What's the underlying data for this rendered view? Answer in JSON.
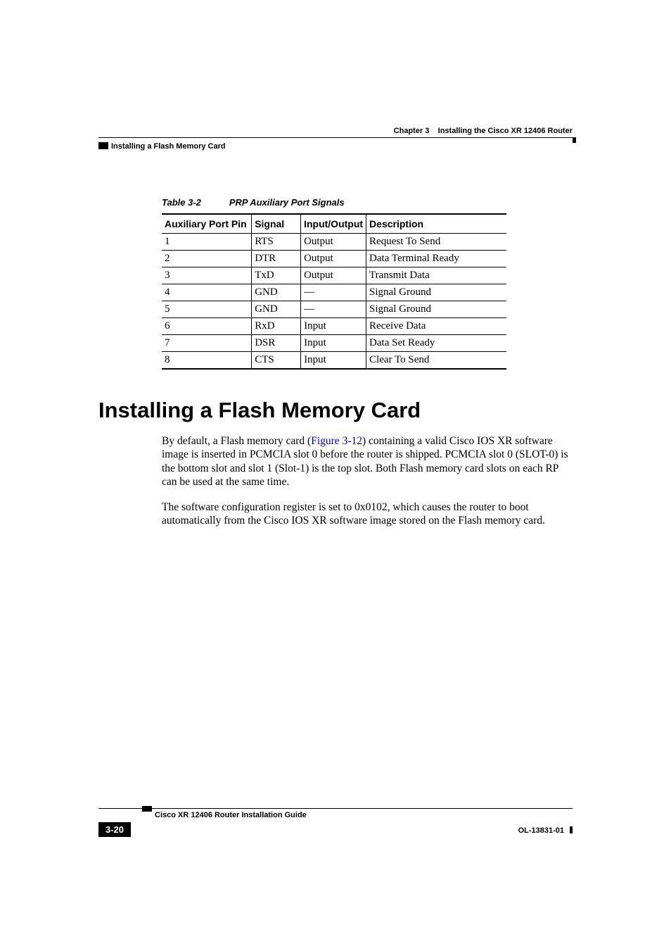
{
  "header": {
    "chapter_label": "Chapter 3",
    "chapter_title": "Installing the Cisco XR 12406 Router",
    "section_name": "Installing a Flash Memory Card"
  },
  "table": {
    "number": "Table 3-2",
    "title": "PRP Auxiliary Port Signals",
    "headers": [
      "Auxiliary Port Pin",
      "Signal",
      "Input/Output",
      "Description"
    ],
    "rows": [
      {
        "pin": "1",
        "signal": "RTS",
        "io": "Output",
        "desc": "Request To Send"
      },
      {
        "pin": "2",
        "signal": "DTR",
        "io": "Output",
        "desc": "Data Terminal Ready"
      },
      {
        "pin": "3",
        "signal": "TxD",
        "io": "Output",
        "desc": "Transmit Data"
      },
      {
        "pin": "4",
        "signal": "GND",
        "io": "—",
        "desc": "Signal Ground"
      },
      {
        "pin": "5",
        "signal": "GND",
        "io": "—",
        "desc": "Signal Ground"
      },
      {
        "pin": "6",
        "signal": "RxD",
        "io": "Input",
        "desc": "Receive Data"
      },
      {
        "pin": "7",
        "signal": "DSR",
        "io": "Input",
        "desc": "Data Set Ready"
      },
      {
        "pin": "8",
        "signal": "CTS",
        "io": "Input",
        "desc": "Clear To Send"
      }
    ]
  },
  "heading": "Installing a Flash Memory Card",
  "paragraphs": {
    "p1_part1": "By default, a Flash memory card (",
    "p1_link": "Figure 3-12",
    "p1_part2": ") containing a valid Cisco IOS XR software image is inserted in PCMCIA slot 0 before the router is shipped. PCMCIA slot 0 (SLOT-0) is the bottom slot and slot 1 (Slot-1) is the top slot. Both Flash memory card slots on each RP can be used at the same time.",
    "p2": "The software configuration register is set to 0x0102, which causes the router to boot automatically from the Cisco IOS XR software image stored on the Flash memory card."
  },
  "footer": {
    "guide_title": "Cisco XR 12406 Router Installation Guide",
    "page_number": "3-20",
    "doc_id": "OL-13831-01"
  }
}
